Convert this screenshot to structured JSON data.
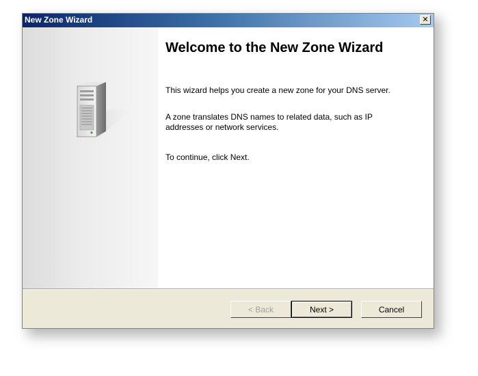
{
  "window": {
    "title": "New Zone Wizard",
    "close_symbol": "✕"
  },
  "banner": {
    "icon": "server-tower-icon"
  },
  "content": {
    "heading": "Welcome to the New Zone Wizard",
    "paragraph1": "This wizard helps you create a new zone for your DNS server.",
    "paragraph2": "A zone translates DNS names to related data, such as IP addresses or network services.",
    "paragraph3": "To continue, click Next."
  },
  "buttons": {
    "back_label": "< Back",
    "next_label": "Next >",
    "cancel_label": "Cancel"
  },
  "colors": {
    "titlebar_start": "#0a246a",
    "titlebar_end": "#a6caf0",
    "dialog_face": "#ece9d8",
    "content_bg": "#ffffff",
    "disabled_text": "#a0a0a0"
  }
}
